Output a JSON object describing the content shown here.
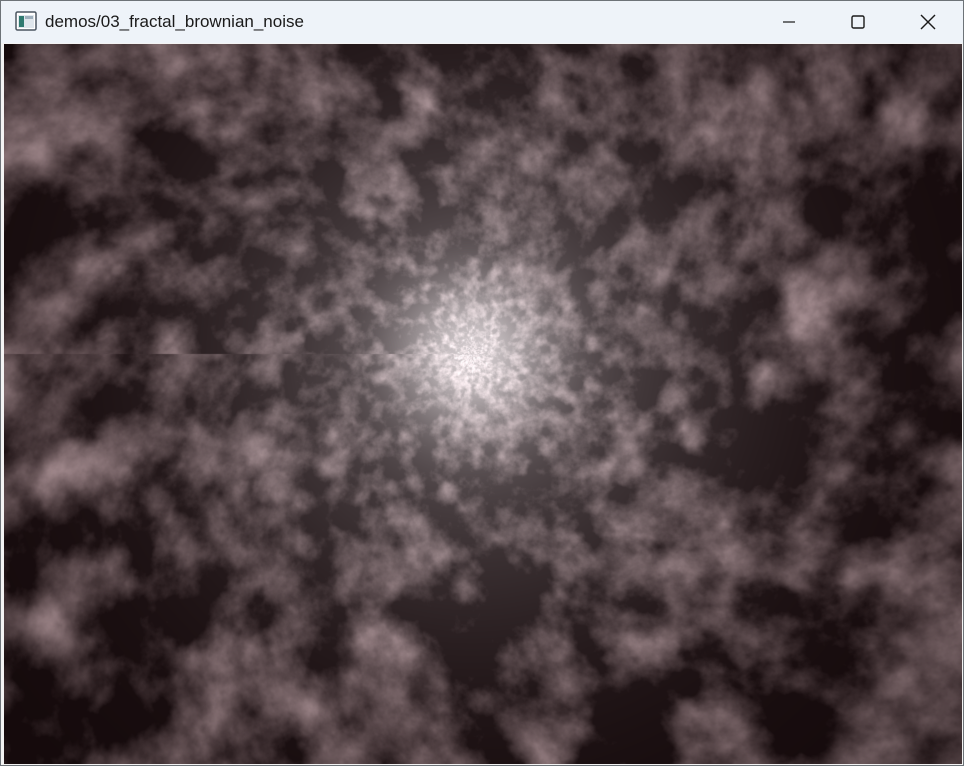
{
  "window": {
    "title": "demos/03_fractal_brownian_noise",
    "app_icon": "terminal-window-icon",
    "controls": {
      "minimize_icon": "minimize-icon",
      "maximize_icon": "maximize-icon",
      "close_icon": "close-icon"
    }
  },
  "render": {
    "description_colors": {
      "dark_spot": "#150707",
      "mid_tone": "#6e5a5c",
      "highlight": "#f4f1f2",
      "cloud_gray": "#8a8585"
    }
  }
}
